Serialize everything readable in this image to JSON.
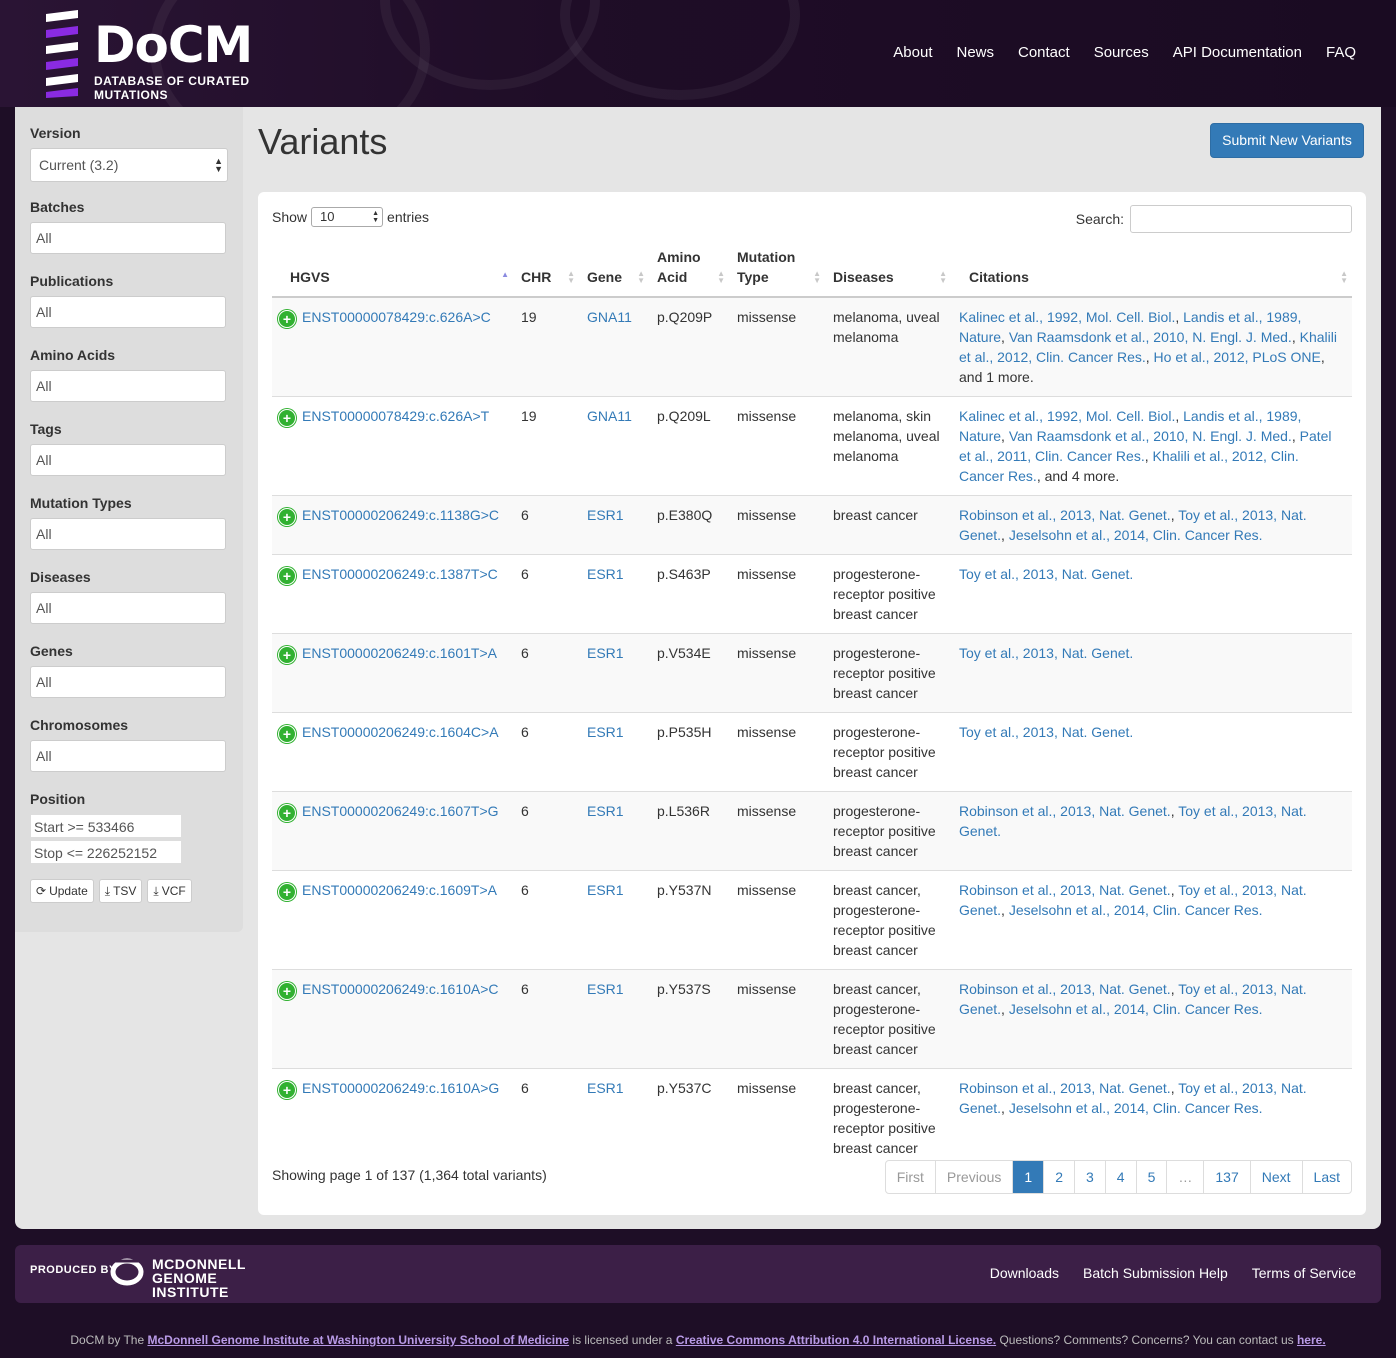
{
  "header": {
    "logo_title": "DoCM",
    "logo_subtitle": "Database of Curated Mutations",
    "nav": [
      "About",
      "News",
      "Contact",
      "Sources",
      "API Documentation",
      "FAQ"
    ]
  },
  "sidebar": {
    "version_label": "Version",
    "version_value": "Current (3.2)",
    "filters": [
      {
        "label": "Batches",
        "value": "All"
      },
      {
        "label": "Publications",
        "value": "All"
      },
      {
        "label": "Amino Acids",
        "value": "All"
      },
      {
        "label": "Tags",
        "value": "All"
      },
      {
        "label": "Mutation Types",
        "value": "All"
      },
      {
        "label": "Diseases",
        "value": "All"
      },
      {
        "label": "Genes",
        "value": "All"
      },
      {
        "label": "Chromosomes",
        "value": "All"
      }
    ],
    "position_label": "Position",
    "start_value": "Start >= 533466",
    "stop_value": "Stop <= 226252152",
    "buttons": {
      "update": "Update",
      "tsv": "TSV",
      "vcf": "VCF"
    }
  },
  "main": {
    "title": "Variants",
    "submit_label": "Submit New Variants",
    "show_label": "Show",
    "show_value": "10",
    "entries_label": "entries",
    "search_label": "Search:",
    "columns": [
      "HGVS",
      "CHR",
      "Gene",
      "Amino Acid",
      "Mutation Type",
      "Diseases",
      "Citations"
    ],
    "rows": [
      {
        "hgvs": "ENST00000078429:c.626A>C",
        "chr": "19",
        "gene": "GNA11",
        "aa": "p.Q209P",
        "type": "missense",
        "diseases": "melanoma, uveal melanoma",
        "citations": [
          "Kalinec et al., 1992, Mol. Cell. Biol.",
          "Landis et al., 1989, Nature",
          "Van Raamsdonk et al., 2010, N. Engl. J. Med.",
          "Khalili et al., 2012, Clin. Cancer Res.",
          "Ho et al., 2012, PLoS ONE"
        ],
        "more": "and 1 more."
      },
      {
        "hgvs": "ENST00000078429:c.626A>T",
        "chr": "19",
        "gene": "GNA11",
        "aa": "p.Q209L",
        "type": "missense",
        "diseases": "melanoma, skin melanoma, uveal melanoma",
        "citations": [
          "Kalinec et al., 1992, Mol. Cell. Biol.",
          "Landis et al., 1989, Nature",
          "Van Raamsdonk et al., 2010, N. Engl. J. Med.",
          "Patel et al., 2011, Clin. Cancer Res.",
          "Khalili et al., 2012, Clin. Cancer Res."
        ],
        "more": "and 4 more."
      },
      {
        "hgvs": "ENST00000206249:c.1138G>C",
        "chr": "6",
        "gene": "ESR1",
        "aa": "p.E380Q",
        "type": "missense",
        "diseases": "breast cancer",
        "citations": [
          "Robinson et al., 2013, Nat. Genet.",
          "Toy et al., 2013, Nat. Genet.",
          "Jeselsohn et al., 2014, Clin. Cancer Res."
        ],
        "more": ""
      },
      {
        "hgvs": "ENST00000206249:c.1387T>C",
        "chr": "6",
        "gene": "ESR1",
        "aa": "p.S463P",
        "type": "missense",
        "diseases": "progesterone-receptor positive breast cancer",
        "citations": [
          "Toy et al., 2013, Nat. Genet."
        ],
        "more": ""
      },
      {
        "hgvs": "ENST00000206249:c.1601T>A",
        "chr": "6",
        "gene": "ESR1",
        "aa": "p.V534E",
        "type": "missense",
        "diseases": "progesterone-receptor positive breast cancer",
        "citations": [
          "Toy et al., 2013, Nat. Genet."
        ],
        "more": ""
      },
      {
        "hgvs": "ENST00000206249:c.1604C>A",
        "chr": "6",
        "gene": "ESR1",
        "aa": "p.P535H",
        "type": "missense",
        "diseases": "progesterone-receptor positive breast cancer",
        "citations": [
          "Toy et al., 2013, Nat. Genet."
        ],
        "more": ""
      },
      {
        "hgvs": "ENST00000206249:c.1607T>G",
        "chr": "6",
        "gene": "ESR1",
        "aa": "p.L536R",
        "type": "missense",
        "diseases": "progesterone-receptor positive breast cancer",
        "citations": [
          "Robinson et al., 2013, Nat. Genet.",
          "Toy et al., 2013, Nat. Genet."
        ],
        "more": ""
      },
      {
        "hgvs": "ENST00000206249:c.1609T>A",
        "chr": "6",
        "gene": "ESR1",
        "aa": "p.Y537N",
        "type": "missense",
        "diseases": "breast cancer, progesterone-receptor positive breast cancer",
        "citations": [
          "Robinson et al., 2013, Nat. Genet.",
          "Toy et al., 2013, Nat. Genet.",
          "Jeselsohn et al., 2014, Clin. Cancer Res."
        ],
        "more": ""
      },
      {
        "hgvs": "ENST00000206249:c.1610A>C",
        "chr": "6",
        "gene": "ESR1",
        "aa": "p.Y537S",
        "type": "missense",
        "diseases": "breast cancer, progesterone-receptor positive breast cancer",
        "citations": [
          "Robinson et al., 2013, Nat. Genet.",
          "Toy et al., 2013, Nat. Genet.",
          "Jeselsohn et al., 2014, Clin. Cancer Res."
        ],
        "more": ""
      },
      {
        "hgvs": "ENST00000206249:c.1610A>G",
        "chr": "6",
        "gene": "ESR1",
        "aa": "p.Y537C",
        "type": "missense",
        "diseases": "breast cancer, progesterone-receptor positive breast cancer",
        "citations": [
          "Robinson et al., 2013, Nat. Genet.",
          "Toy et al., 2013, Nat. Genet.",
          "Jeselsohn et al., 2014, Clin. Cancer Res."
        ],
        "more": ""
      }
    ],
    "info": "Showing page 1 of 137 (1,364 total variants)",
    "pagination": [
      {
        "label": "First",
        "state": "disabled"
      },
      {
        "label": "Previous",
        "state": "disabled"
      },
      {
        "label": "1",
        "state": "active"
      },
      {
        "label": "2",
        "state": ""
      },
      {
        "label": "3",
        "state": ""
      },
      {
        "label": "4",
        "state": ""
      },
      {
        "label": "5",
        "state": ""
      },
      {
        "label": "…",
        "state": "disabled"
      },
      {
        "label": "137",
        "state": ""
      },
      {
        "label": "Next",
        "state": ""
      },
      {
        "label": "Last",
        "state": ""
      }
    ]
  },
  "footer": {
    "produced_by": "PRODUCED BY",
    "institute_line1": "McDonnell",
    "institute_line2": "Genome Institute",
    "links": [
      "Downloads",
      "Batch Submission Help",
      "Terms of Service"
    ],
    "license_prefix": "DoCM by The",
    "license_link1": "McDonnell Genome Institute at Washington University School of Medicine",
    "license_mid": "is licensed under a",
    "license_link2": "Creative Commons Attribution 4.0 International License.",
    "license_suffix": "Questions? Comments? Concerns? You can contact us",
    "license_link3": "here."
  },
  "colors": {
    "accent": "#337ab7",
    "header_bg": "#1e0e26",
    "footer_bg": "#3c1f47",
    "add_icon": "#31b131"
  }
}
